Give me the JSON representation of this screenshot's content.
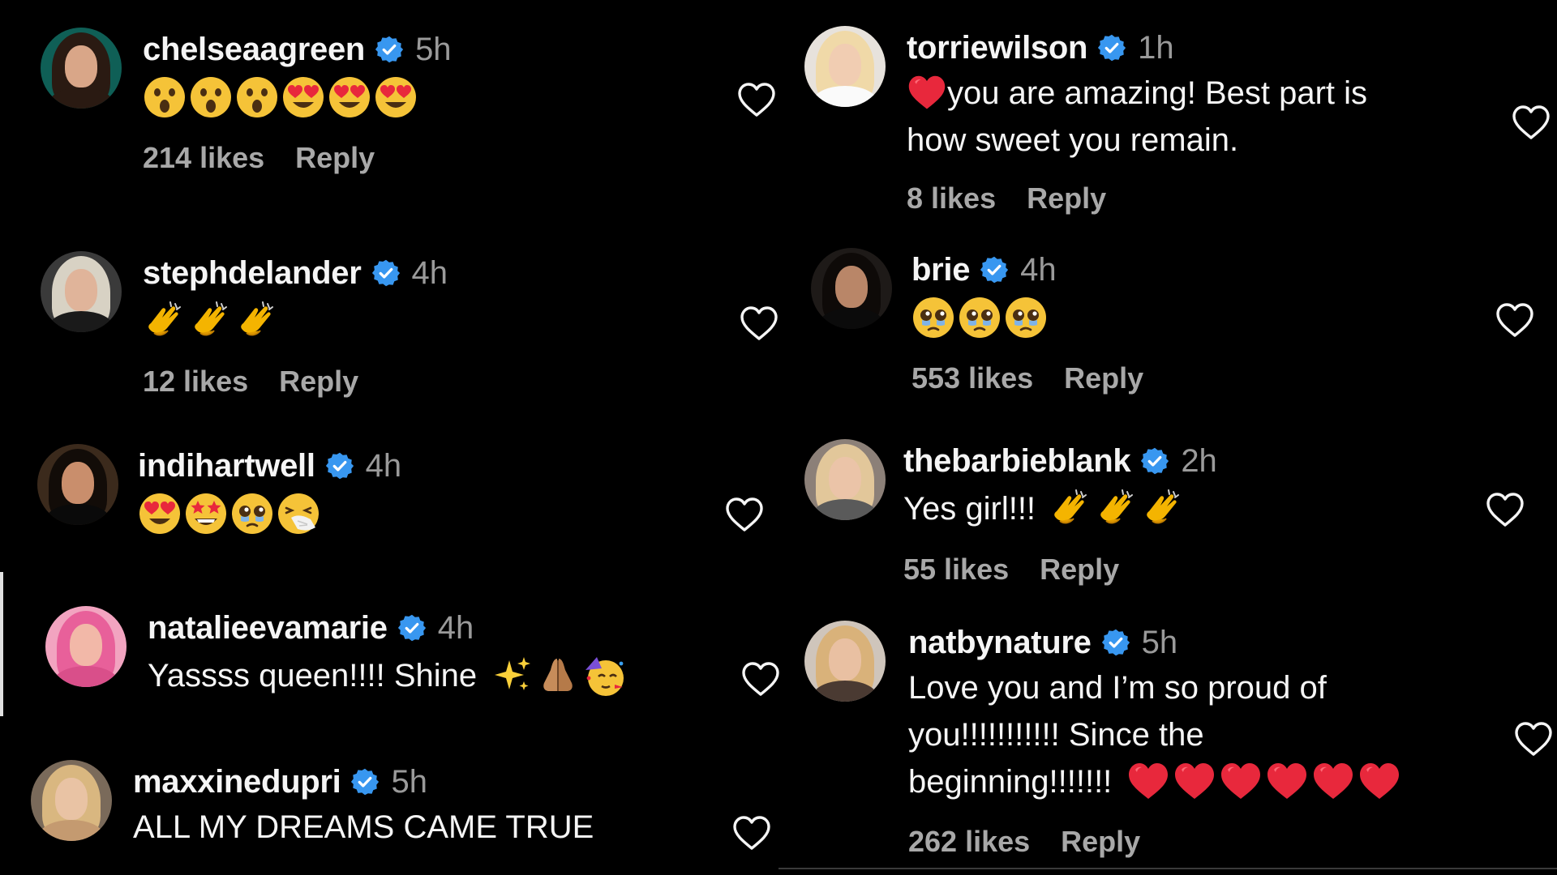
{
  "left_comments": [
    {
      "username": "chelseaagreen",
      "time": "5h",
      "emojis": [
        "astonished",
        "astonished",
        "astonished",
        "heart-eyes",
        "heart-eyes",
        "heart-eyes"
      ],
      "likes": "214 likes",
      "reply": "Reply"
    },
    {
      "username": "stephdelander",
      "time": "4h",
      "emojis": [
        "clap",
        "clap",
        "clap"
      ],
      "likes": "12 likes",
      "reply": "Reply"
    },
    {
      "username": "indihartwell",
      "time": "4h",
      "emojis": [
        "heart-eyes",
        "star-struck",
        "pleading",
        "sneezing"
      ]
    },
    {
      "username": "natalieevamarie",
      "time": "4h",
      "text": "Yassss queen!!!! Shine",
      "emojis": [
        "sparkles",
        "folded-hands",
        "partying"
      ]
    },
    {
      "username": "maxxinedupri",
      "time": "5h",
      "text": "ALL MY DREAMS CAME TRUE"
    }
  ],
  "right_comments": [
    {
      "username": "torriewilson",
      "time": "1h",
      "lines": [
        "you are amazing! Best part is",
        "how sweet you remain."
      ],
      "likes": "8 likes",
      "reply": "Reply"
    },
    {
      "username": "brie",
      "time": "4h",
      "emojis": [
        "pleading",
        "pleading",
        "pleading"
      ],
      "likes": "553 likes",
      "reply": "Reply"
    },
    {
      "username": "thebarbieblank",
      "time": "2h",
      "text": "Yes girl!!!",
      "emojis": [
        "clap",
        "clap",
        "clap"
      ],
      "likes": "55 likes",
      "reply": "Reply"
    },
    {
      "username": "natbynature",
      "time": "5h",
      "lines": [
        "Love you and I’m so proud of",
        "you!!!!!!!!!!! Since the",
        "beginning!!!!!!!"
      ],
      "emojis": [
        "red-heart",
        "red-heart",
        "red-heart",
        "red-heart",
        "red-heart",
        "red-heart"
      ],
      "likes": "262 likes",
      "reply": "Reply"
    }
  ],
  "colors": {
    "background": "#000000",
    "verified_badge": "#3897f0",
    "secondary_text": "#a8a8a8",
    "heart_outline": "#f5f5f5"
  },
  "icons": {
    "verified": "verified-badge-icon",
    "like": "heart-outline-icon"
  }
}
